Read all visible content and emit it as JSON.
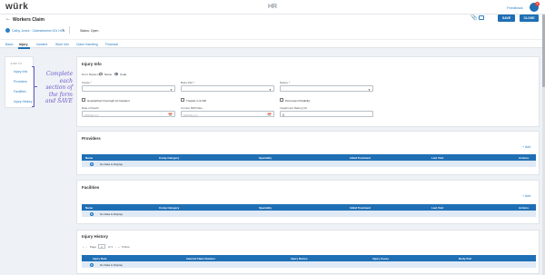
{
  "app": {
    "logo": "würk",
    "title": "HR",
    "feedback": "Feedback",
    "notification_count": "9"
  },
  "header": {
    "title": "Workers Claim",
    "claimant": "Cathy Jones · Claimdesriew 001 HLs",
    "status_label": "Status: Open",
    "save": "SAVE",
    "close": "CLOSE"
  },
  "tabs": [
    "Basic",
    "Injury",
    "Incident",
    "Work Info",
    "Claim Handling",
    "Financial"
  ],
  "active_tab": "Injury",
  "left_nav": {
    "heading": "JUMP TO",
    "items": [
      "Injury Info",
      "Providers",
      "Facilities",
      "Injury History"
    ]
  },
  "hint": "Complete each section of the form and SAVE",
  "injury_info": {
    "title": "Injury Info",
    "dont_relate_label": "Don't Relate by",
    "radio_options": [
      "Name",
      "Code"
    ],
    "cause_label": "Cause *",
    "body_part_label": "Body Part *",
    "nature_label": "Nature *",
    "checkboxes": [
      "Hospitalized Overnight As Inpatient",
      "Treated in At ER",
      "Permanent Disability"
    ],
    "date_of_death_label": "Date of Death",
    "date_placeholder": "MM/dd/yyyy",
    "current_mmi_label": "Current MMI Date",
    "impairment_label": "Impairment Rating (%)",
    "impairment_value": "0"
  },
  "providers": {
    "title": "Providers",
    "add": "+ Add",
    "columns": [
      "Name",
      "Comp Category",
      "Speciality",
      "Initial Treatment",
      "Last Visit",
      "Actions"
    ],
    "empty": "No Data to Display"
  },
  "facilities": {
    "title": "Facilities",
    "add": "+ Add",
    "columns": [
      "Name",
      "Comp Category",
      "Speciality",
      "Initial Treatment",
      "Last Visit",
      "Actions"
    ],
    "empty": "No Data to Display"
  },
  "injury_history": {
    "title": "Injury History",
    "pager": {
      "page_label": "Page",
      "page_value": "1",
      "of_label": "of 1",
      "rows_label": "5 Row"
    },
    "columns": [
      "Injury Date",
      "Internal Claim Number",
      "Injury Nature",
      "Injury Cause",
      "Body Part"
    ],
    "empty": "No Data to Display"
  },
  "colors": {
    "primary": "#1f6fb5",
    "link": "#2b7fc4",
    "hint": "#6a5acd",
    "empty_row": "#dfeaf6"
  }
}
